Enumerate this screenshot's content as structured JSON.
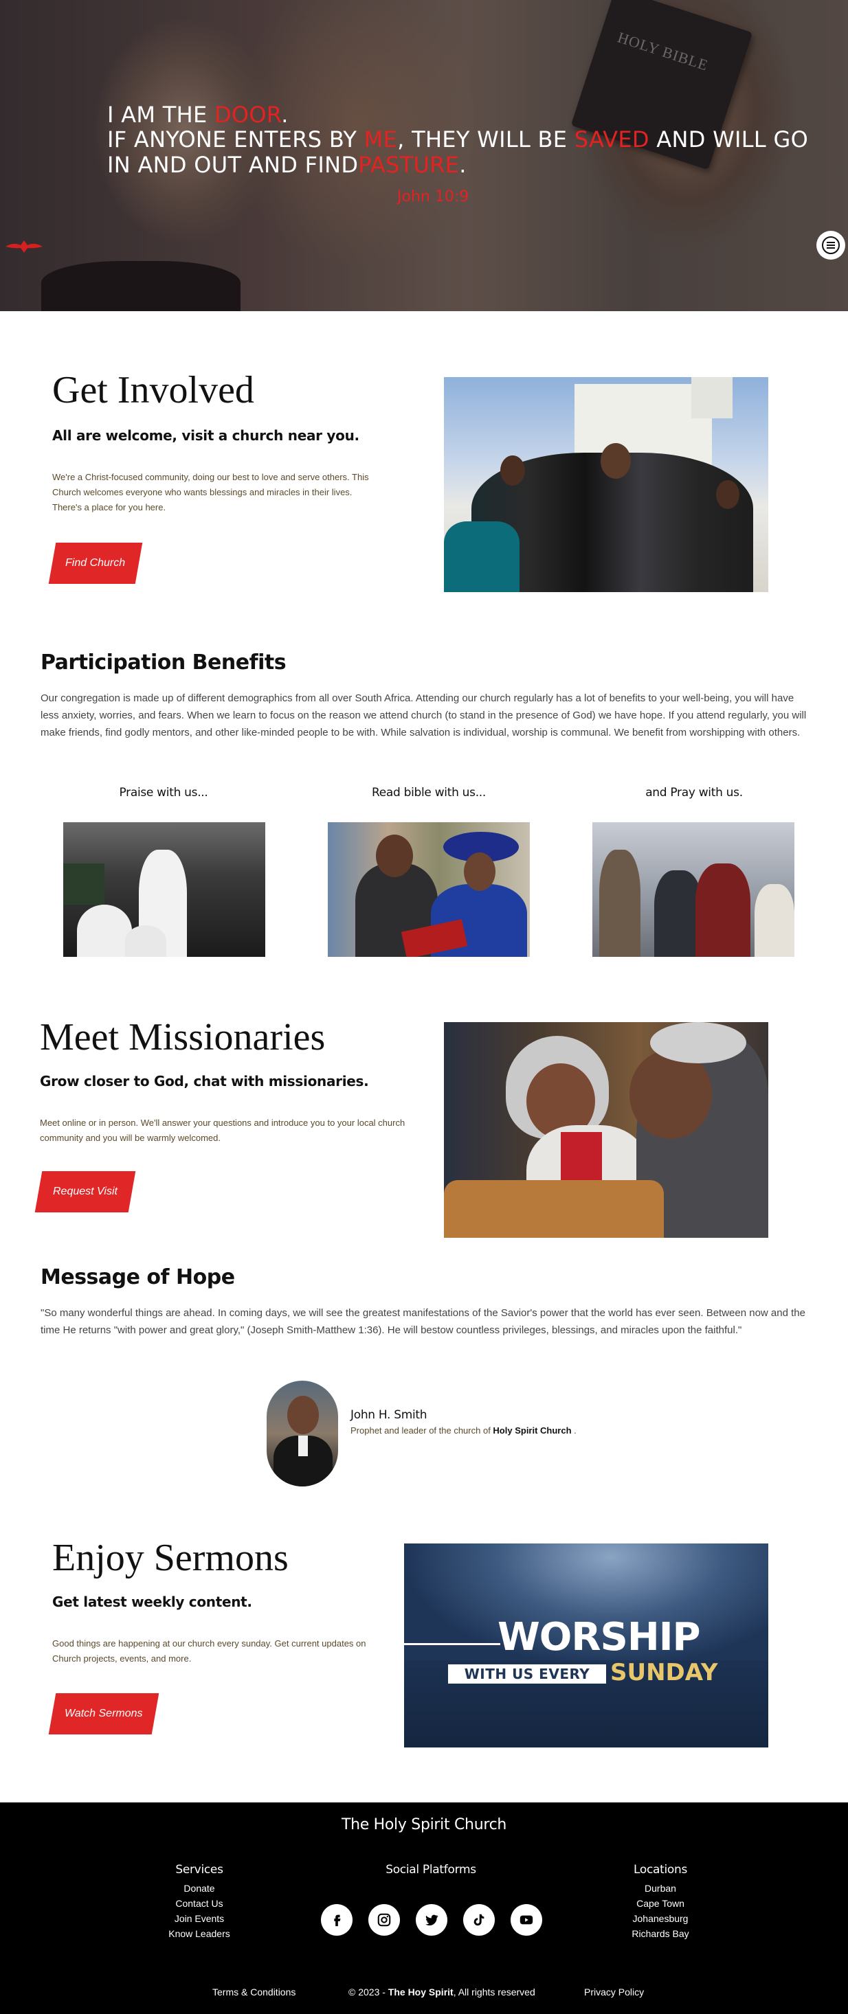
{
  "hero": {
    "line1_a": "I AM THE ",
    "line1_b": "DOOR",
    "line1_c": ".",
    "line2_a": "IF ANYONE ENTERS BY ",
    "line2_b": "ME",
    "line2_c": ", THEY WILL BE ",
    "line2_d": "SAVED",
    "line2_e": " AND WILL GO",
    "line3_a": "IN AND OUT AND FIND",
    "line3_b": "PASTURE",
    "line3_c": ".",
    "reference": "John 10:9",
    "bible_text": "HOLY BIBLE",
    "menu_icon": "hamburger-menu-icon"
  },
  "get_involved": {
    "title": "Get Involved",
    "subtitle": "All are welcome, visit a church near you.",
    "body": "We're a Christ-focused community, doing our best to love and serve others. This Church welcomes everyone who wants blessings and miracles in their lives. There's a place for you here.",
    "button": "Find Church"
  },
  "benefits": {
    "title": "Participation Benefits",
    "body": "Our congregation is made up of different demographics from all over South Africa. Attending our church regularly has a lot of benefits to your well-being, you will have less anxiety, worries, and fears. When we learn to focus on the reason we attend church (to stand in the presence of God) we have hope. If you attend regularly, you will make friends, find godly mentors, and other like-minded people to be with. While salvation is individual, worship is communal. We benefit from worshipping with others.",
    "items": [
      {
        "caption": "Praise with us..."
      },
      {
        "caption": "Read bible with us..."
      },
      {
        "caption": "and Pray with us."
      }
    ]
  },
  "missionaries": {
    "title": "Meet Missionaries",
    "subtitle": "Grow closer to God, chat with missionaries.",
    "body": "Meet online or in person. We'll answer your questions and introduce you to your local church community and you will be warmly welcomed.",
    "button": "Request Visit"
  },
  "hope": {
    "title": "Message of Hope",
    "quote": "\"So many wonderful things are ahead. In coming days, we will see the greatest manifestations of the Savior's power that the world has ever seen. Between now and the time He returns \"with power and great glory,\" (Joseph Smith-Matthew 1:36). He will bestow countless privileges, blessings, and miracles upon the faithful.\"",
    "author_name": "John H. Smith",
    "author_role_prefix": "Prophet and leader of the church of ",
    "author_role_church": "Holy Spirit Church",
    "author_role_suffix": " ."
  },
  "sermons": {
    "title": "Enjoy Sermons",
    "subtitle": "Get latest weekly content.",
    "body": "Good things are happening at our church every sunday. Get current updates on Church projects, events, and more.",
    "button": "Watch Sermons",
    "banner_line1": "WORSHIP",
    "banner_line2a": "WITH US EVERY",
    "banner_line2b": "SUNDAY"
  },
  "footer": {
    "title": "The Holy Spirit Church",
    "services_title": "Services",
    "services": [
      "Donate",
      "Contact Us",
      "Join Events",
      "Know Leaders"
    ],
    "social_title": "Social Platforms",
    "social_icons": [
      "facebook-icon",
      "instagram-icon",
      "twitter-icon",
      "tiktok-icon",
      "youtube-icon"
    ],
    "locations_title": "Locations",
    "locations": [
      "Durban",
      "Cape Town",
      "Johanesburg",
      "Richards Bay"
    ],
    "terms": "Terms & Conditions",
    "copyright_prefix": "© 2023 - ",
    "copyright_brand": "The Hoy Spirit",
    "copyright_suffix": ", All rights reserved",
    "privacy": "Privacy Policy"
  },
  "colors": {
    "accent": "#e02626",
    "footer_bg": "#000000",
    "banner_navy": "#1e3558",
    "banner_gold": "#e8c66a"
  }
}
